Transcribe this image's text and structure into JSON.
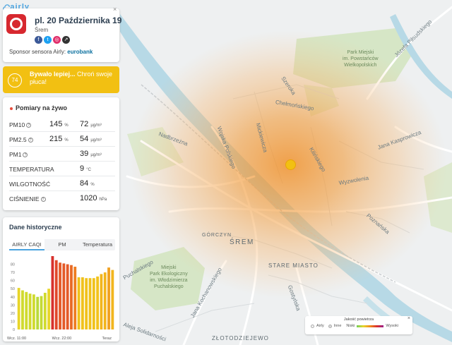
{
  "app": {
    "logo_text": "airly",
    "close_symbol": "×"
  },
  "station": {
    "name": "pl. 20 Października 19",
    "city": "Śrem",
    "sponsor_prefix": "Sponsor sensora Airly:",
    "sponsor_name": "eurobank"
  },
  "caqi": {
    "value": "74",
    "message_bold": "Bywało lepiej...",
    "message": " Chroń swoje płuca!",
    "color": "#f2c012"
  },
  "live": {
    "title": "Pomiary na żywo",
    "info_symbol": "?",
    "rows": [
      {
        "label": "PM10",
        "pct": "145",
        "pct_unit": "%",
        "value": "72",
        "unit": "µg/m³"
      },
      {
        "label": "PM2.5",
        "pct": "215",
        "pct_unit": "%",
        "value": "54",
        "unit": "µg/m³"
      },
      {
        "label": "PM1",
        "pct": "",
        "pct_unit": "",
        "value": "39",
        "unit": "µg/m³"
      },
      {
        "label": "TEMPERATURA",
        "pct": "",
        "pct_unit": "",
        "value": "9",
        "unit": "°C"
      },
      {
        "label": "WILGOTNOŚĆ",
        "pct": "",
        "pct_unit": "",
        "value": "84",
        "unit": "%"
      },
      {
        "label": "CIŚNIENIE",
        "pct": "",
        "pct_unit": "",
        "value": "1020",
        "unit": "hPa"
      }
    ]
  },
  "history": {
    "title": "Dane historyczne",
    "tabs": [
      "AIRLY CAQI",
      "PM",
      "Temperatura"
    ],
    "active_tab": 0
  },
  "chart_data": {
    "type": "bar",
    "yticks": [
      0,
      10,
      20,
      30,
      40,
      50,
      60,
      70,
      80
    ],
    "ylim": [
      0,
      90
    ],
    "xticks": [
      "Wcz. 11:00",
      "Wcz. 22:00",
      "Teraz"
    ],
    "values": [
      51,
      48,
      46,
      44,
      43,
      40,
      41,
      45,
      50,
      90,
      85,
      82,
      81,
      80,
      79,
      77,
      64,
      64,
      63,
      63,
      63,
      65,
      68,
      70,
      76,
      73
    ],
    "colors": [
      "#e8d52a",
      "#d0da2e",
      "#d0da2e",
      "#d0da2e",
      "#d0da2e",
      "#b9d93a",
      "#c4da34",
      "#d0da2e",
      "#e8d52a",
      "#d7302c",
      "#e0472a",
      "#e45a28",
      "#e45a28",
      "#e45a28",
      "#e86a25",
      "#ee7d21",
      "#f0c21a",
      "#f0c21a",
      "#f0c21a",
      "#f0c21a",
      "#f0c21a",
      "#f2c31a",
      "#f2b51d",
      "#f2b51d",
      "#f0a01f",
      "#f2b51d"
    ]
  },
  "map": {
    "town_main": "ŚREM",
    "town_stare": "STARE MIASTO",
    "town_gorczyn": "GÓRCZYN",
    "town_zlot": "ZŁOTODZIEJEWO",
    "park1": "Park Miejski\nim. Powstańców\nWielkopolskich",
    "park2": "Miejski\nPark Ekologiczny\nim. Włodzimierza\nPuchalskiego",
    "streets": [
      {
        "name": "Józefa Piłsudskiego"
      },
      {
        "name": "Nadbrzeżna"
      },
      {
        "name": "Szeroka"
      },
      {
        "name": "Wojska Polskiego"
      },
      {
        "name": "Jana Kochanowskiego"
      },
      {
        "name": "Jana Kasprowicza"
      },
      {
        "name": "Puchalskiego"
      },
      {
        "name": "Aleja Solidarności"
      },
      {
        "name": "Wyzwolenia"
      },
      {
        "name": "Kilińskiego"
      },
      {
        "name": "Mickiewicza"
      },
      {
        "name": "Chełmońskiego"
      },
      {
        "name": "Poznańska"
      },
      {
        "name": "Gostyńska"
      }
    ]
  },
  "legend": {
    "title": "Jakość powietrza",
    "items": [
      "Airly",
      "Inne",
      "Niski",
      "Wysoki"
    ],
    "close_symbol": "×"
  }
}
